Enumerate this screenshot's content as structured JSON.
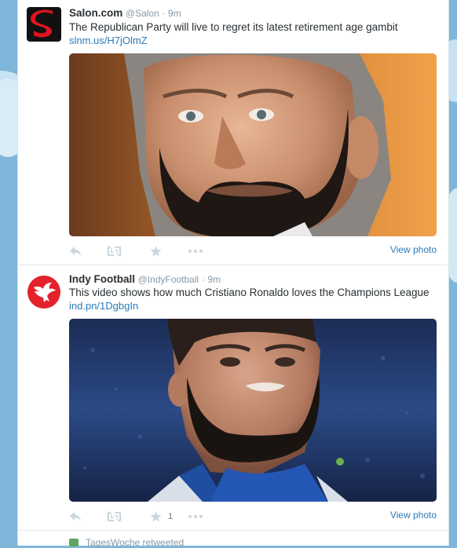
{
  "tweets": [
    {
      "fullname": "Salon.com",
      "handle": "@Salon",
      "separator": "·",
      "time": "9m",
      "text": "The Republican Party will live to regret its latest retirement age gambit",
      "link": "slnm.us/H7jOlmZ",
      "view_photo": "View photo",
      "favorite_count": "",
      "avatar_icon": "salon-logo-icon"
    },
    {
      "fullname": "Indy Football",
      "handle": "@IndyFootball",
      "separator": "·",
      "time": "9m",
      "text": "This video shows how much Cristiano Ronaldo loves the Champions League",
      "link": "ind.pn/1DgbgIn",
      "view_photo": "View photo",
      "favorite_count": "1",
      "avatar_icon": "independent-eagle-logo-icon"
    }
  ],
  "next_tweet": {
    "retweeted_label": "TagesWoche retweeted"
  },
  "colors": {
    "link": "#2b7bb9",
    "name": "#292f33",
    "meta": "#8899a6",
    "action_icon": "#ccd6dd",
    "background": "#7fb6d9"
  }
}
